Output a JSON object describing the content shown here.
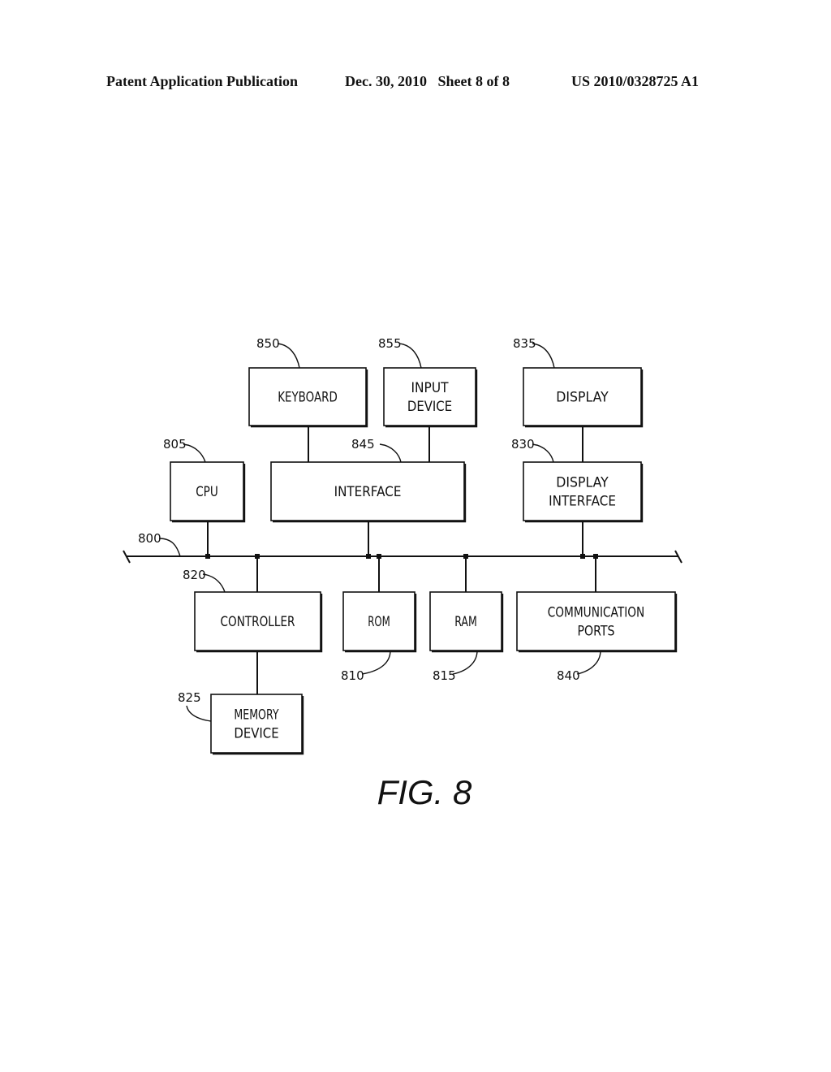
{
  "header": {
    "left": "Patent Application Publication",
    "middle": "Dec. 30, 2010   Sheet 8 of 8",
    "right": "US 2010/0328725 A1"
  },
  "figure": {
    "caption": "FIG. 8",
    "bus_ref": "800",
    "blocks": {
      "keyboard": {
        "label": [
          "KEYBOARD"
        ],
        "ref": "850"
      },
      "input_device": {
        "label": [
          "INPUT",
          "DEVICE"
        ],
        "ref": "855"
      },
      "display": {
        "label": [
          "DISPLAY"
        ],
        "ref": "835"
      },
      "cpu": {
        "label": [
          "CPU"
        ],
        "ref": "805"
      },
      "interface": {
        "label": [
          "INTERFACE"
        ],
        "ref": "845"
      },
      "display_interface": {
        "label": [
          "DISPLAY",
          "INTERFACE"
        ],
        "ref": "830"
      },
      "controller": {
        "label": [
          "CONTROLLER"
        ],
        "ref": "820"
      },
      "rom": {
        "label": [
          "ROM"
        ],
        "ref": "810"
      },
      "ram": {
        "label": [
          "RAM"
        ],
        "ref": "815"
      },
      "communication_ports": {
        "label": [
          "COMMUNICATION",
          "PORTS"
        ],
        "ref": "840"
      },
      "memory_device": {
        "label": [
          "MEMORY",
          "DEVICE"
        ],
        "ref": "825"
      }
    }
  }
}
